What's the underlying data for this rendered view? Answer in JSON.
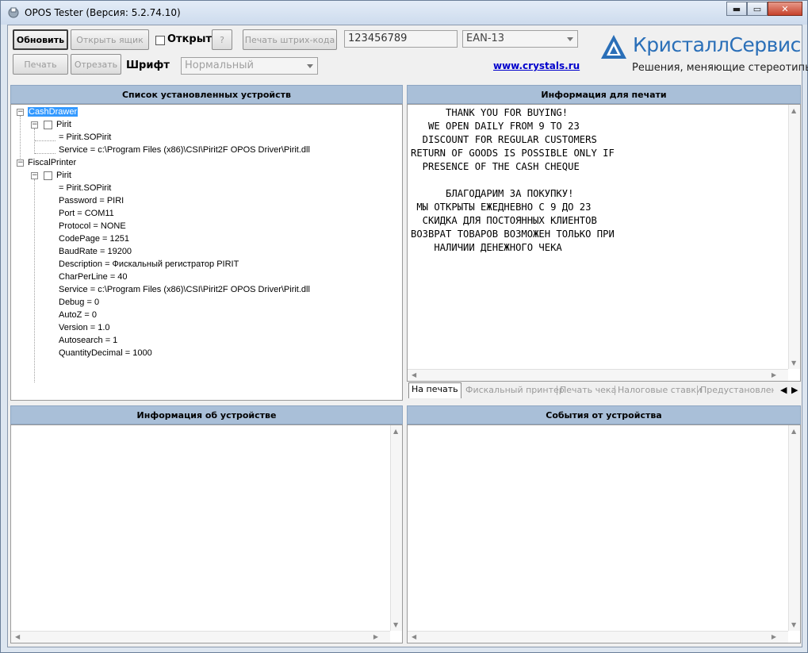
{
  "window": {
    "title": "OPOS Tester (Версия: 5.2.74.10)",
    "min": "▬",
    "max": "▭",
    "close": "✕"
  },
  "toolbar": {
    "refresh": "Обновить",
    "open_drawer": "Открыть ящик",
    "open_label": "Открыт",
    "help": "?",
    "print_barcode": "Печать штрих-кода",
    "barcode_value": "123456789",
    "barcode_type": "EAN-13",
    "print": "Печать",
    "cut": "Отрезать",
    "font_label": "Шрифт",
    "font_value": "Нормальный"
  },
  "link": "www.crystals.ru",
  "logo": {
    "name": "КристаллСервис",
    "slogan": "Решения, меняющие стереотипы"
  },
  "panels": {
    "devices": "Список установленных устройств",
    "print_info": "Информация для печати",
    "device_info": "Информация об устройстве",
    "device_events": "События от устройства"
  },
  "tree": {
    "cash_drawer": "CashDrawer",
    "cd_device": "Pirit",
    "cd_props": [
      " = Pirit.SOPirit",
      "Service = c:\\Program Files (x86)\\CSI\\Pirit2F OPOS Driver\\Pirit.dll"
    ],
    "fiscal_printer": "FiscalPrinter",
    "fp_device": "Pirit",
    "fp_props": [
      " = Pirit.SOPirit",
      "Password = PIRI",
      "Port = COM11",
      "Protocol = NONE",
      "CodePage = 1251",
      "BaudRate = 19200",
      "Description = Фискальный регистратор PIRIT",
      "CharPerLine = 40",
      "Service = c:\\Program Files (x86)\\CSI\\Pirit2F OPOS Driver\\Pirit.dll",
      "Debug = 0",
      "AutoZ = 0",
      "Version = 1.0",
      "Autosearch = 1",
      "QuantityDecimal = 1000"
    ]
  },
  "print_lines": [
    "      THANK YOU FOR BUYING!",
    "   WE OPEN DAILY FROM 9 TO 23",
    "  DISCOUNT FOR REGULAR CUSTOMERS",
    "RETURN OF GOODS IS POSSIBLE ONLY IF",
    "  PRESENCE OF THE CASH CHEQUE",
    "",
    "      БЛАГОДАРИМ ЗА ПОКУПКУ!",
    " МЫ ОТКРЫТЫ ЕЖЕДНЕВНО С 9 ДО 23",
    "  СКИДКА ДЛЯ ПОСТОЯННЫХ КЛИЕНТОВ",
    "ВОЗВРАТ ТОВАРОВ ВОЗМОЖЕН ТОЛЬКО ПРИ",
    "    НАЛИЧИИ ДЕНЕЖНОГО ЧЕКА"
  ],
  "tabs": [
    "На печать",
    "Фискальный принтер",
    "Печать чека",
    "Налоговые ставки",
    "Предустановленн"
  ],
  "icons": {
    "tab_prev": "◀",
    "tab_next": "▶",
    "scroll_up": "▲",
    "scroll_down": "▼",
    "scroll_left": "◀",
    "scroll_right": "▶",
    "collapse": "−"
  },
  "colors": {
    "header_bg": "#a9bfd8",
    "selection": "#3399ff",
    "link": "#0000cc",
    "logo": "#2a6fb8"
  }
}
